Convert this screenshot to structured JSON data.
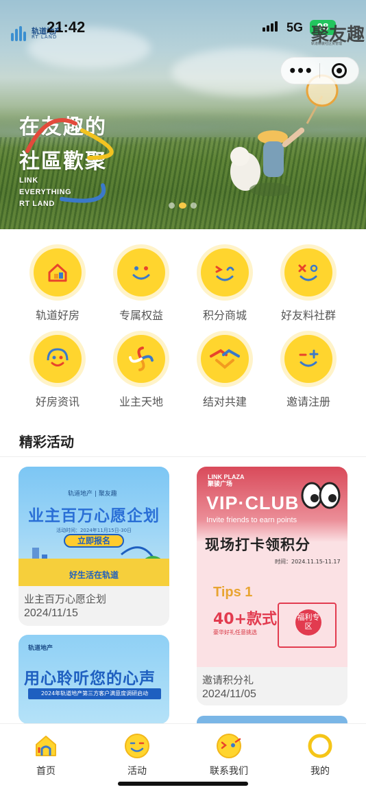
{
  "status_bar": {
    "time": "21:42",
    "network": "5G",
    "battery": "98"
  },
  "brand": {
    "logo_cn": "轨道地产",
    "logo_en": "RT LAND"
  },
  "app_logo": {
    "text": "聚友趣",
    "sub": "轨道精装社区贸管理"
  },
  "banner": {
    "line1": "在友趣的",
    "line2": "社區歡聚",
    "en_lines": [
      "LINK",
      "EVERYTHING",
      "RT LAND"
    ],
    "active_dot": 1
  },
  "menu": [
    {
      "label": "轨道好房",
      "icon": "house-icon"
    },
    {
      "label": "专属权益",
      "icon": "smile-face-icon"
    },
    {
      "label": "积分商城",
      "icon": "wink-face-icon"
    },
    {
      "label": "好友料社群",
      "icon": "cross-eyes-face-icon"
    },
    {
      "label": "好房资讯",
      "icon": "headset-face-icon"
    },
    {
      "label": "业主天地",
      "icon": "pinwheel-icon"
    },
    {
      "label": "结对共建",
      "icon": "handshake-icon"
    },
    {
      "label": "邀请注册",
      "icon": "plus-face-icon"
    }
  ],
  "section": {
    "title": "精彩活动"
  },
  "activities": [
    {
      "title": "业主百万心愿企划",
      "date": "2024/11/15",
      "poster": {
        "logo": "轨道地产 | 聚友趣",
        "headline": "业主百万心愿企划",
        "dates": "活动时间：2024年11月15日-30日",
        "button": "立即报名",
        "footer": "好生活在轨道"
      }
    },
    {
      "title": "邀请积分礼",
      "date": "2024/11/05",
      "poster": {
        "brand": "LINK PLAZA",
        "brand_cn": "聚骏广场",
        "vip": "VIP·CLUB",
        "invite": "Invite friends to earn points",
        "headline": "现场打卡领积分",
        "time": "时间：2024.11.15-11.17",
        "tips": "Tips 1",
        "count": "40+款式",
        "desc": "豪华好礼任意挑选",
        "gift": "福利专区"
      }
    },
    {
      "title": "",
      "date": "",
      "poster": {
        "logo": "轨道地产",
        "headline": "用心聆听您的心声",
        "banner": "2024年轨道地产第三方客户满意度调研启动"
      }
    }
  ],
  "tabbar": [
    {
      "label": "首页",
      "icon": "home-icon"
    },
    {
      "label": "活动",
      "icon": "activity-face-icon"
    },
    {
      "label": "联系我们",
      "icon": "contact-face-icon"
    },
    {
      "label": "我的",
      "icon": "profile-ring-icon"
    }
  ],
  "colors": {
    "accent": "#ffd52e",
    "accent_ring": "#fff3c9",
    "brand_blue": "#1e5fc0"
  }
}
